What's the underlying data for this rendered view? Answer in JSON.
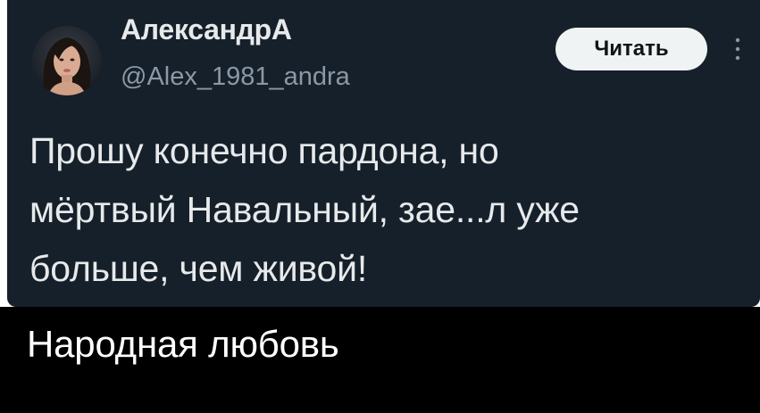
{
  "tweet": {
    "display_name": "АлександрА",
    "handle": "@Alex_1981_andra",
    "follow_button_label": "Читать",
    "text_lines": [
      "Прошу конечно пардона, но",
      "мёртвый Навальный, зае...л уже",
      "больше, чем живой!"
    ]
  },
  "caption": {
    "text": "Народная любовь"
  },
  "colors": {
    "card_background": "#15202b",
    "primary_text": "#e7e9ea",
    "secondary_text": "#8b98a5",
    "button_background": "#eff3f4",
    "caption_background": "#000000"
  },
  "icons": {
    "more": "more-vertical-icon",
    "avatar": "profile-photo"
  }
}
